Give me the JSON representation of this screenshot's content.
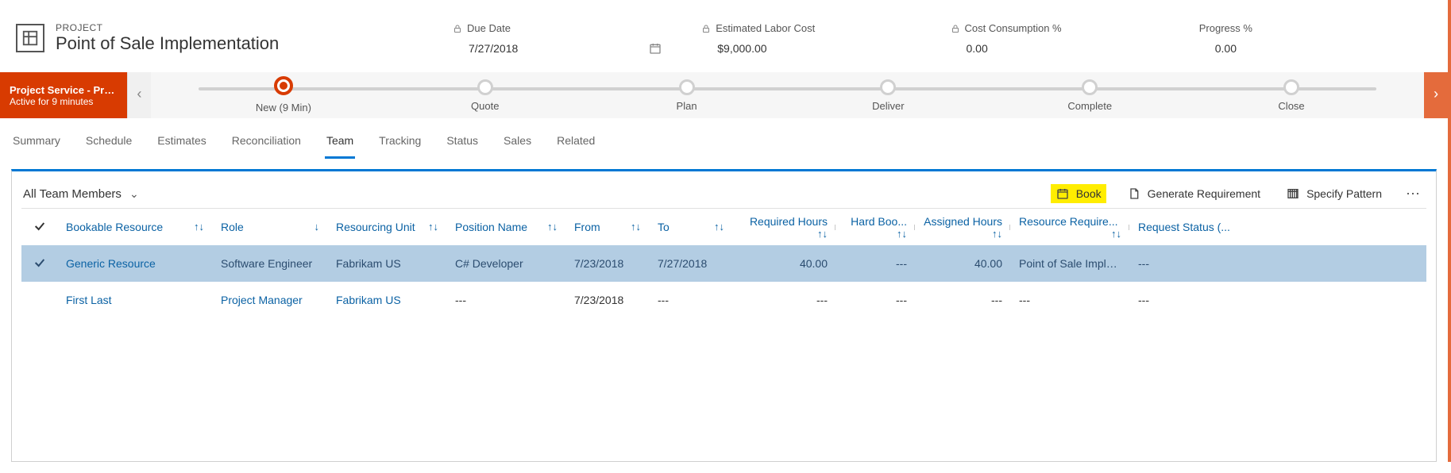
{
  "header": {
    "entity_type": "PROJECT",
    "entity_title": "Point of Sale Implementation",
    "cards": [
      {
        "label": "Due Date",
        "value": "7/27/2018",
        "locked": true,
        "has_calendar": true
      },
      {
        "label": "Estimated Labor Cost",
        "value": "$9,000.00",
        "locked": true
      },
      {
        "label": "Cost Consumption %",
        "value": "0.00",
        "locked": true
      },
      {
        "label": "Progress %",
        "value": "0.00",
        "locked": false
      }
    ]
  },
  "process": {
    "flow_name": "Project Service - Project ...",
    "active_text": "Active for 9 minutes",
    "stages": [
      {
        "label": "New  (9 Min)",
        "active": true
      },
      {
        "label": "Quote",
        "active": false
      },
      {
        "label": "Plan",
        "active": false
      },
      {
        "label": "Deliver",
        "active": false
      },
      {
        "label": "Complete",
        "active": false
      },
      {
        "label": "Close",
        "active": false
      }
    ]
  },
  "tabs": [
    {
      "label": "Summary",
      "active": false
    },
    {
      "label": "Schedule",
      "active": false
    },
    {
      "label": "Estimates",
      "active": false
    },
    {
      "label": "Reconciliation",
      "active": false
    },
    {
      "label": "Team",
      "active": true
    },
    {
      "label": "Tracking",
      "active": false
    },
    {
      "label": "Status",
      "active": false
    },
    {
      "label": "Sales",
      "active": false
    },
    {
      "label": "Related",
      "active": false
    }
  ],
  "panel": {
    "view_name": "All Team Members",
    "commands": {
      "book": "Book",
      "gen_req": "Generate Requirement",
      "pattern": "Specify Pattern"
    },
    "columns": [
      "Bookable Resource",
      "Role",
      "Resourcing Unit",
      "Position Name",
      "From",
      "To",
      "Required Hours",
      "Hard Boo...",
      "Assigned Hours",
      "Resource Require...",
      "Request Status (..."
    ],
    "rows": [
      {
        "selected": true,
        "bookable_resource": "Generic Resource",
        "role": "Software Engineer",
        "resourcing_unit": "Fabrikam US",
        "position_name": "C# Developer",
        "from": "7/23/2018",
        "to": "7/27/2018",
        "required_hours": "40.00",
        "hard_booked": "---",
        "assigned_hours": "40.00",
        "resource_req": "Point of Sale Implem...",
        "request_status": "---"
      },
      {
        "selected": false,
        "bookable_resource": "First Last",
        "role": "Project Manager",
        "resourcing_unit": "Fabrikam US",
        "position_name": "---",
        "from": "7/23/2018",
        "to": "---",
        "required_hours": "---",
        "hard_booked": "---",
        "assigned_hours": "---",
        "resource_req": "---",
        "request_status": "---"
      }
    ]
  }
}
